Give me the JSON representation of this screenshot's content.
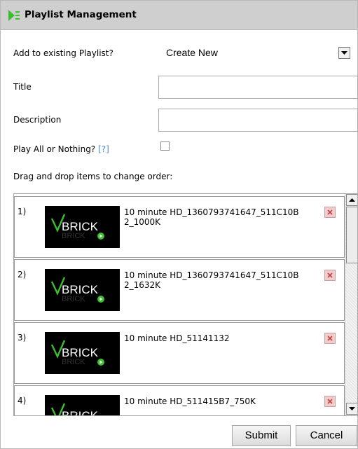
{
  "dialog": {
    "title": "Playlist Management",
    "colors": {
      "titlebar_bg": "#cfcfcf",
      "logo_green": "#3bbf2f",
      "help_link": "#4a86d6",
      "remove_bg": "#f2cccc"
    }
  },
  "form": {
    "playlist_label": "Add to existing Playlist?",
    "playlist_value": "Create New",
    "title_label": "Title",
    "title_value": "",
    "description_label": "Description",
    "description_value": "",
    "play_all_label": "Play All or Nothing?",
    "play_all_help": "[?]",
    "play_all_checked": false,
    "drag_hint": "Drag and drop items to change order:"
  },
  "items": [
    {
      "num": "1)",
      "name": "10 minute HD_1360793741647_511C10B2_1000K",
      "thumb_text": "BRICK"
    },
    {
      "num": "2)",
      "name": "10 minute HD_1360793741647_511C10B2_1632K",
      "thumb_text": "BRICK"
    },
    {
      "num": "3)",
      "name": "10 minute HD_51141132",
      "thumb_text": "BRICK"
    },
    {
      "num": "4)",
      "name": "10 minute HD_511415B7_750K",
      "thumb_text": "BRICK"
    }
  ],
  "icons": {
    "logo": "playlist-logo-icon",
    "dropdown": "chevron-down-icon",
    "remove": "close-icon",
    "scroll_up": "arrow-up-icon",
    "scroll_down": "arrow-down-icon",
    "thumb_play": "play-dot-icon"
  },
  "buttons": {
    "submit": "Submit",
    "cancel": "Cancel"
  }
}
